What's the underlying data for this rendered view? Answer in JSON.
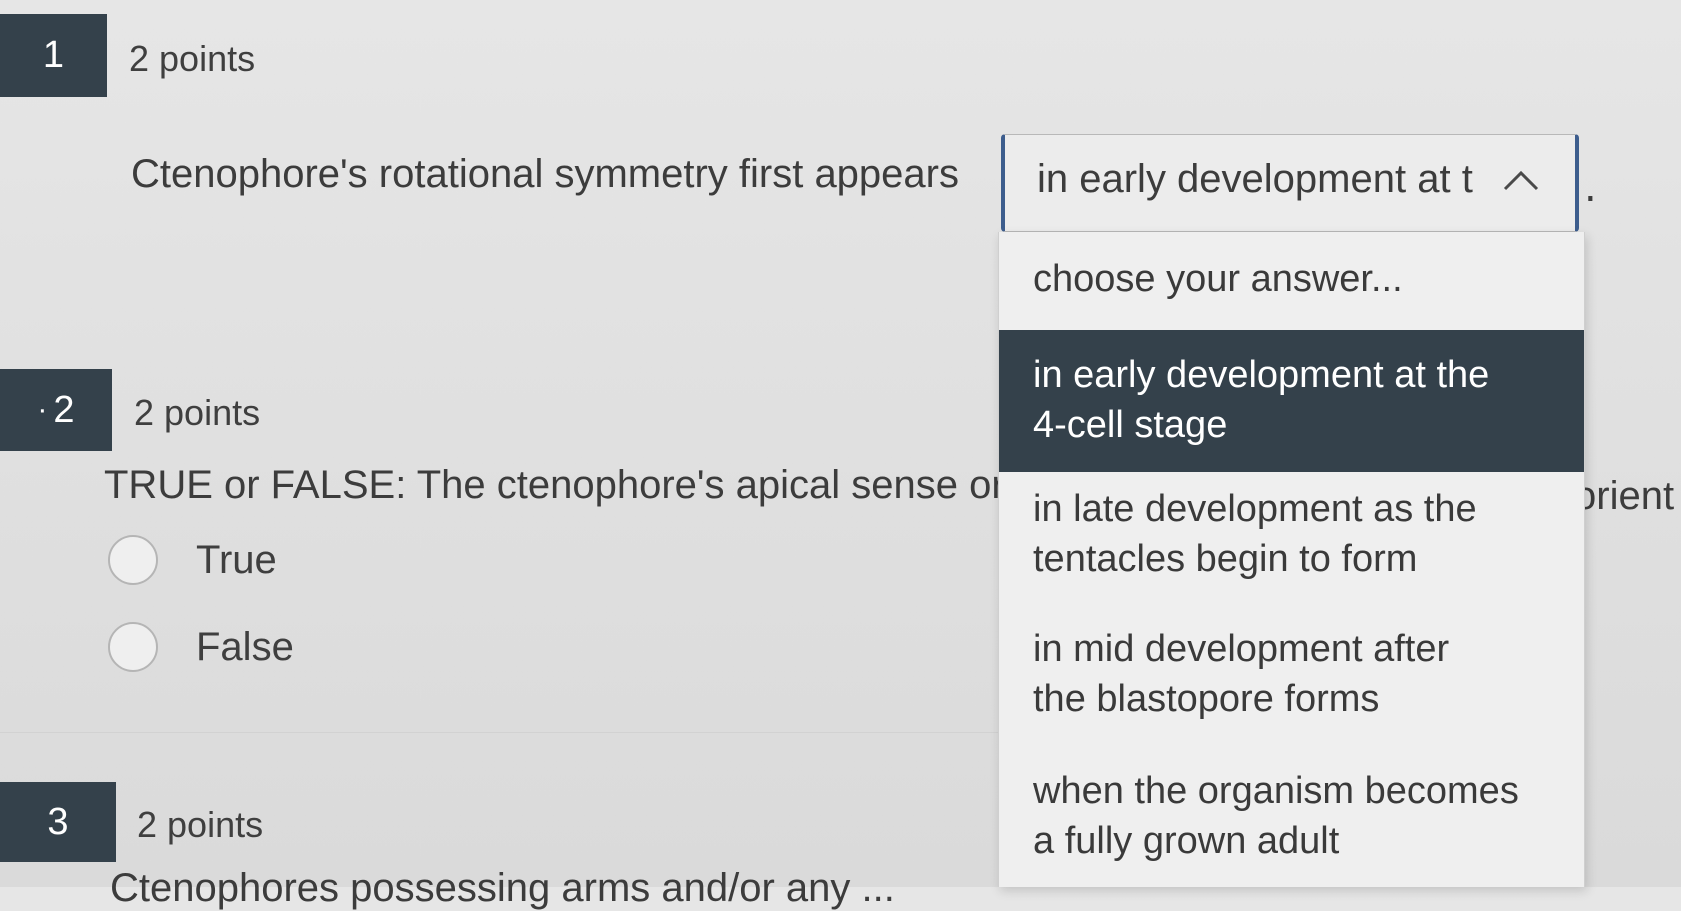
{
  "questions": [
    {
      "number": "1",
      "points": "2 points",
      "text": "Ctenophore's rotational symmetry first appears",
      "after": "."
    },
    {
      "number": "2",
      "marker": "·",
      "points": "2 points",
      "text": "TRUE or FALSE: The ctenophore's apical sense org",
      "text_tail": "orient",
      "options": [
        "True",
        "False"
      ]
    },
    {
      "number": "3",
      "points": "2 points",
      "text": "Ctenophores possessing arms and/or any ... "
    }
  ],
  "dropdown": {
    "selected_value": "in early development at t",
    "selected_index": 1,
    "expanded": true,
    "options": [
      {
        "line1": "choose your answer...",
        "line2": ""
      },
      {
        "line1": "in early development at the",
        "line2": "4-cell stage"
      },
      {
        "line1": "in late development as the",
        "line2": "tentacles begin to form"
      },
      {
        "line1": "in mid development after",
        "line2": "the blastopore forms"
      },
      {
        "line1": "when the organism becomes",
        "line2": "a fully grown adult"
      }
    ]
  },
  "colors": {
    "badge": "#34414b",
    "focus_border": "#3d5d8d",
    "selected_option": "#34414b"
  }
}
